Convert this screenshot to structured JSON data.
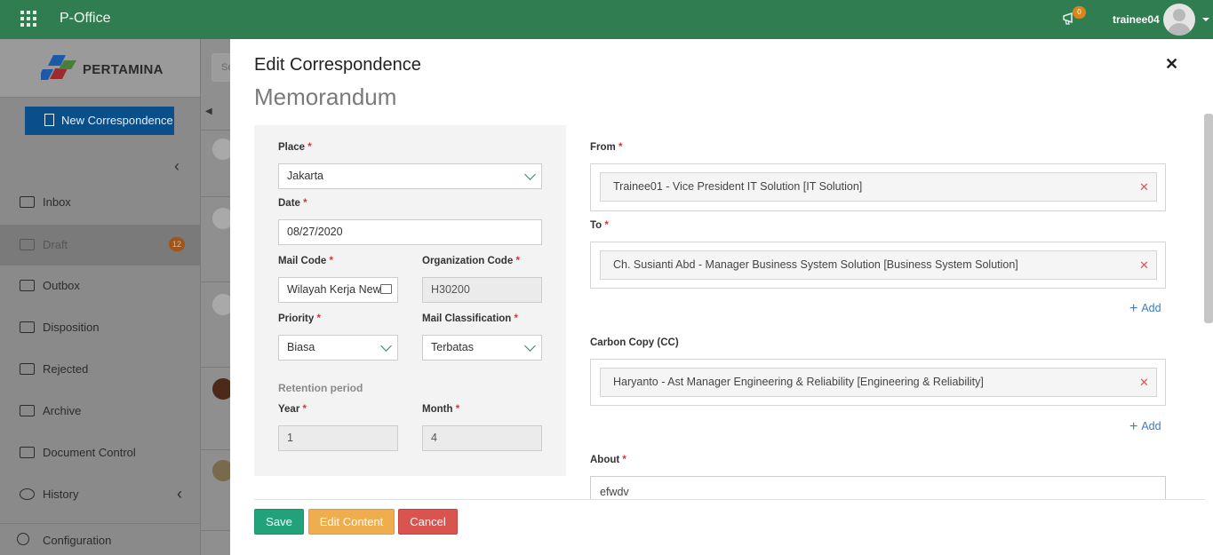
{
  "topbar": {
    "app_title": "P-Office",
    "notification_count": "0",
    "username": "trainee04",
    "icons": [
      "apps-grid-icon",
      "megaphone-icon",
      "user-avatar",
      "caret-down-icon"
    ]
  },
  "sidebar": {
    "brand": "PERTAMINA",
    "new_button": "New Correspondence",
    "items": [
      {
        "label": "Inbox",
        "icon": "inbox-icon"
      },
      {
        "label": "Draft",
        "icon": "draft-icon",
        "badge": "12",
        "active": true
      },
      {
        "label": "Outbox",
        "icon": "outbox-icon"
      },
      {
        "label": "Disposition",
        "icon": "disposition-icon"
      },
      {
        "label": "Rejected",
        "icon": "rejected-icon"
      },
      {
        "label": "Archive",
        "icon": "archive-icon"
      },
      {
        "label": "Document Control",
        "icon": "document-control-icon"
      },
      {
        "label": "History",
        "icon": "history-icon"
      }
    ],
    "configuration": "Configuration"
  },
  "midcol": {
    "search_placeholder": "Se"
  },
  "modal": {
    "title": "Edit Correspondence",
    "subtitle": "Memorandum",
    "left": {
      "place_label": "Place",
      "place_value": "Jakarta",
      "date_label": "Date",
      "date_value": "08/27/2020",
      "mail_code_label": "Mail Code",
      "mail_code_value": "Wilayah Kerja New",
      "org_code_label": "Organization Code",
      "org_code_value": "H30200",
      "priority_label": "Priority",
      "priority_value": "Biasa",
      "mail_class_label": "Mail Classification",
      "mail_class_value": "Terbatas",
      "retention_label": "Retention period",
      "year_label": "Year",
      "year_value": "1",
      "month_label": "Month",
      "month_value": "4"
    },
    "right": {
      "from_label": "From",
      "from_value": "Trainee01 - Vice President IT Solution [IT Solution]",
      "to_label": "To",
      "to_value": "Ch. Susianti Abd - Manager Business System Solution [Business System Solution]",
      "add_label": "Add",
      "cc_label": "Carbon Copy (CC)",
      "cc_value": "Haryanto - Ast Manager Engineering & Reliability [Engineering & Reliability]",
      "about_label": "About",
      "about_value": "efwdv"
    },
    "buttons": {
      "save": "Save",
      "edit_content": "Edit Content",
      "cancel": "Cancel"
    }
  },
  "colors": {
    "topbar": "#2f7d50",
    "save": "#21a27a",
    "edit": "#f0ad4e",
    "cancel": "#d9534f",
    "link": "#3a7fc0",
    "required": "#dd3333"
  }
}
